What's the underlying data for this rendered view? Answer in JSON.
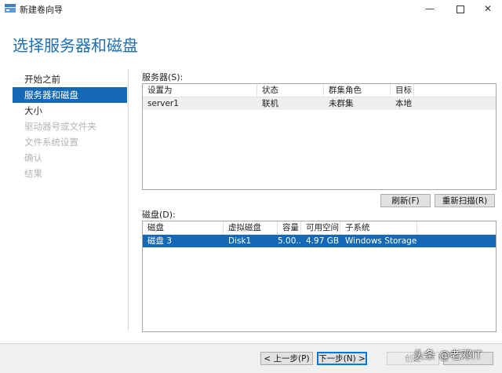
{
  "window": {
    "title": "新建卷向导",
    "minimize": "—",
    "close": "✕"
  },
  "page_title": "选择服务器和磁盘",
  "nav": {
    "items": [
      {
        "label": "开始之前",
        "state": "normal"
      },
      {
        "label": "服务器和磁盘",
        "state": "active"
      },
      {
        "label": "大小",
        "state": "normal"
      },
      {
        "label": "驱动器号或文件夹",
        "state": "disabled"
      },
      {
        "label": "文件系统设置",
        "state": "disabled"
      },
      {
        "label": "确认",
        "state": "disabled"
      },
      {
        "label": "结果",
        "state": "disabled"
      }
    ]
  },
  "servers": {
    "label": "服务器(S):",
    "columns": [
      "设置为",
      "状态",
      "群集角色",
      "目标"
    ],
    "rows": [
      {
        "name": "server1",
        "status": "联机",
        "role": "未群集",
        "target": "本地"
      }
    ],
    "refresh_label": "刷新(F)",
    "rescan_label": "重新扫描(R)"
  },
  "disks": {
    "label": "磁盘(D):",
    "columns": [
      "磁盘",
      "虚拟磁盘",
      "容量",
      "可用空间",
      "子系统"
    ],
    "rows": [
      {
        "disk": "磁盘 3",
        "vdisk": "Disk1",
        "capacity": "5.00...",
        "free": "4.97 GB",
        "subsystem": "Windows Storage"
      }
    ]
  },
  "footer": {
    "prev_label": "< 上一步(P)",
    "next_label": "下一步(N) >",
    "create_label": "创建"
  },
  "watermark": "头条 @老邓IT",
  "colors": {
    "accent": "#1f6fb2",
    "selection": "#1468b4"
  }
}
